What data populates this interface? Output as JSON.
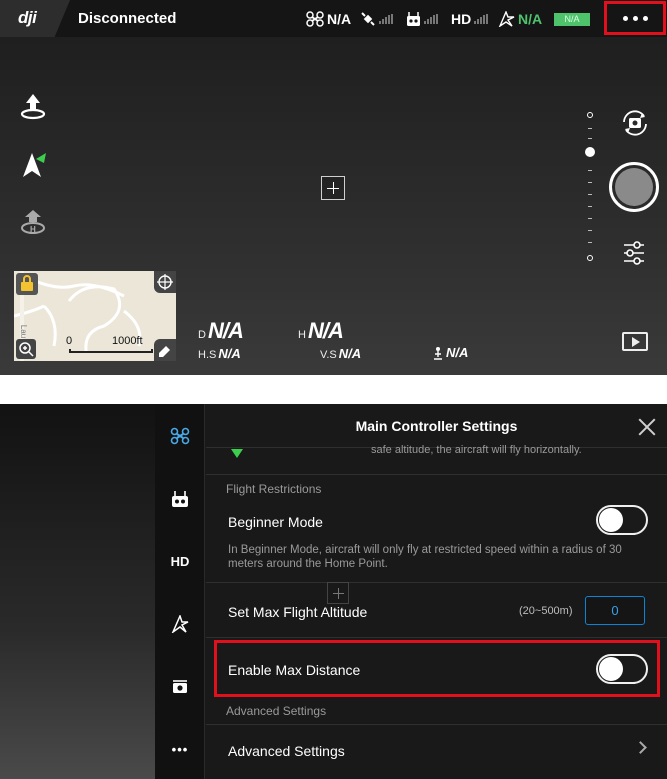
{
  "topbar": {
    "status": "Disconnected",
    "aircraft_value": "N/A",
    "flight_mode_value": "N/A",
    "battery_badge": "N/A",
    "hd_label": "HD",
    "logo_text": "dji"
  },
  "minimap": {
    "scale_start": "0",
    "scale_end": "1000ft",
    "street_label": "Lau"
  },
  "telemetry": {
    "d_label": "D",
    "d_value": "N/A",
    "h_label": "H",
    "h_value": "N/A",
    "hs_label": "H.S",
    "hs_value": "N/A",
    "vs_label": "V.S",
    "vs_value": "N/A",
    "vps_value": "N/A"
  },
  "settings": {
    "title": "Main Controller Settings",
    "cut_text": "safe altitude, the aircraft will fly horizontally.",
    "section_flight_restrictions": "Flight Restrictions",
    "beginner_mode_label": "Beginner Mode",
    "beginner_mode_desc": "In Beginner Mode, aircraft will only fly at restricted speed within a radius of 30 meters around the Home Point.",
    "beginner_mode_on": false,
    "max_altitude_label": "Set Max Flight Altitude",
    "max_altitude_range": "(20~500m)",
    "max_altitude_value": "0",
    "enable_max_distance_label": "Enable Max Distance",
    "enable_max_distance_on": false,
    "section_advanced": "Advanced Settings",
    "advanced_settings_label": "Advanced Settings"
  },
  "side_tabs": {
    "hd_label": "HD",
    "more_label": "•••"
  },
  "colors": {
    "highlight": "#e0111c",
    "accent_blue": "#3aa0ea",
    "battery_green": "#4fc36c",
    "aircraft_tab_blue": "#4aa8e8"
  }
}
